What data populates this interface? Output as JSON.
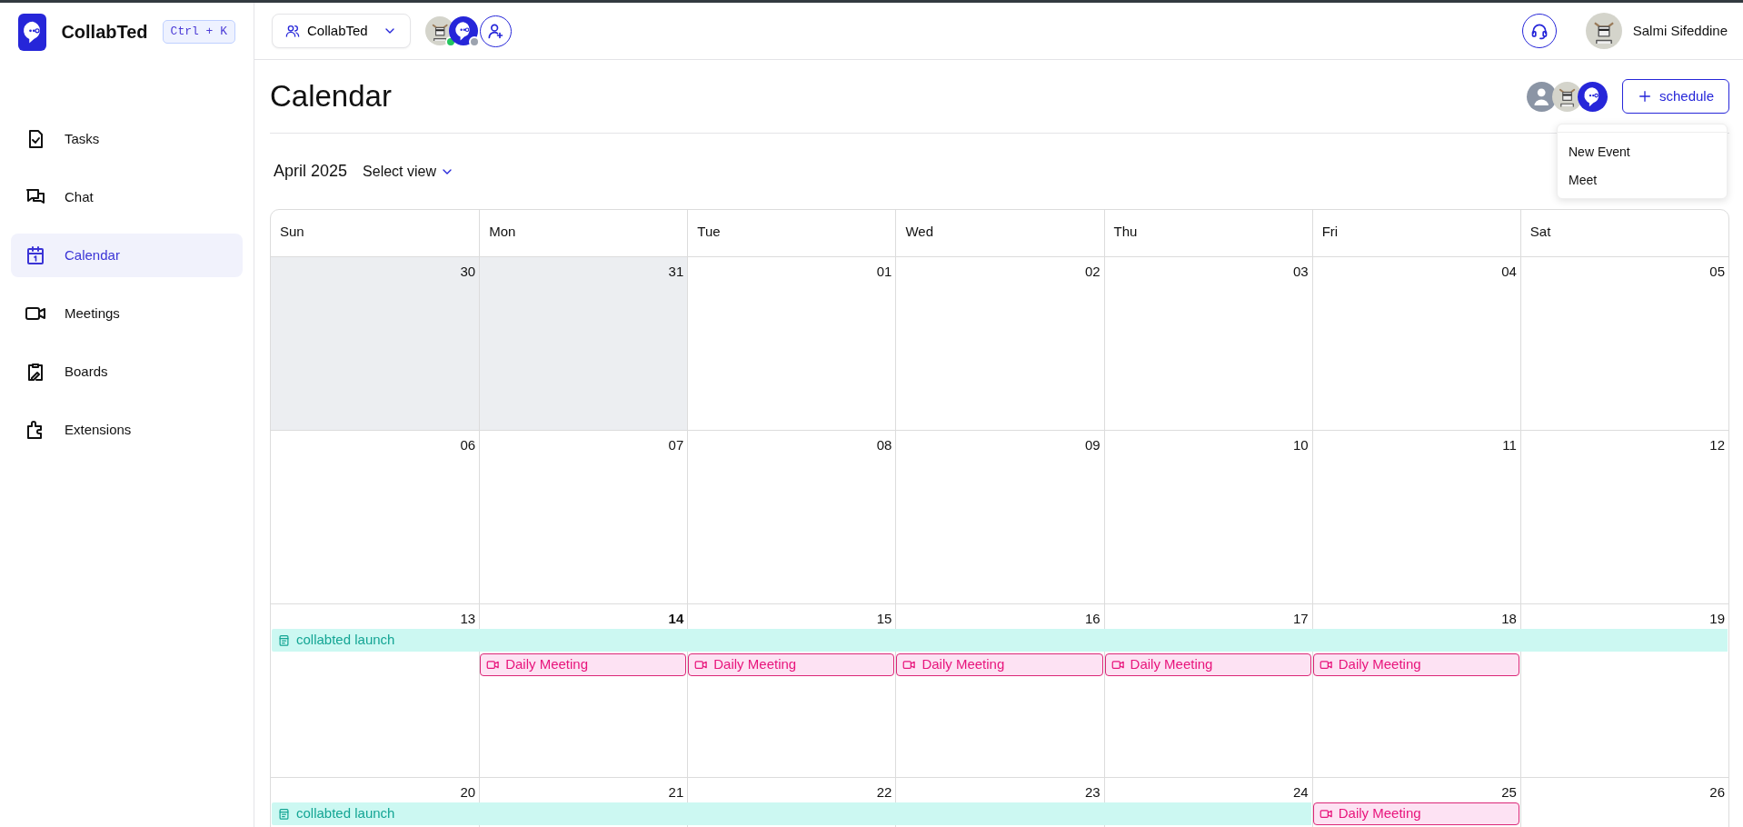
{
  "sidebar": {
    "brand": "CollabTed",
    "shortcut": "Ctrl + K",
    "items": [
      {
        "label": "Tasks",
        "kind": "tasks",
        "selected": false
      },
      {
        "label": "Chat",
        "kind": "chat",
        "selected": false
      },
      {
        "label": "Calendar",
        "kind": "calendar",
        "selected": true
      },
      {
        "label": "Meetings",
        "kind": "meetings",
        "selected": false
      },
      {
        "label": "Boards",
        "kind": "boards",
        "selected": false
      },
      {
        "label": "Extensions",
        "kind": "extensions",
        "selected": false
      }
    ]
  },
  "topbar": {
    "workspace": "CollabTed",
    "members": [
      {
        "kind": "avatar",
        "color": "#22c55e"
      },
      {
        "kind": "logo",
        "color": "#9ca3af"
      },
      {
        "kind": "invite"
      }
    ],
    "user": "Salmi Sifeddine"
  },
  "header": {
    "title": "Calendar",
    "participants": [
      {
        "kind": "user"
      },
      {
        "kind": "avatar"
      },
      {
        "kind": "logo"
      }
    ],
    "schedule_button": "schedule",
    "menu": {
      "open": true,
      "items": [
        "New Event",
        "Meet"
      ]
    }
  },
  "toolbar": {
    "month": "April 2025",
    "view_select": "Select view"
  },
  "calendar": {
    "weekdays": [
      "Sun",
      "Mon",
      "Tue",
      "Wed",
      "Thu",
      "Fri",
      "Sat"
    ],
    "weeks": [
      {
        "days": [
          {
            "date": "30",
            "outside": true,
            "today": false
          },
          {
            "date": "31",
            "outside": true,
            "today": false
          },
          {
            "date": "01",
            "outside": false,
            "today": false
          },
          {
            "date": "02",
            "outside": false,
            "today": false
          },
          {
            "date": "03",
            "outside": false,
            "today": false
          },
          {
            "date": "04",
            "outside": false,
            "today": false
          },
          {
            "date": "05",
            "outside": false,
            "today": false
          }
        ]
      },
      {
        "days": [
          {
            "date": "06",
            "outside": false,
            "today": false
          },
          {
            "date": "07",
            "outside": false,
            "today": false
          },
          {
            "date": "08",
            "outside": false,
            "today": false
          },
          {
            "date": "09",
            "outside": false,
            "today": false
          },
          {
            "date": "10",
            "outside": false,
            "today": false
          },
          {
            "date": "11",
            "outside": false,
            "today": false
          },
          {
            "date": "12",
            "outside": false,
            "today": false
          }
        ]
      },
      {
        "days": [
          {
            "date": "13",
            "outside": false,
            "today": false,
            "events": [
              {
                "kind": "task",
                "title": "collabted launch",
                "continued": false
              }
            ]
          },
          {
            "date": "14",
            "outside": false,
            "today": true,
            "events": [
              {
                "kind": "task",
                "continued": true
              },
              {
                "kind": "meeting",
                "title": "Daily Meeting",
                "continued": false
              }
            ]
          },
          {
            "date": "15",
            "outside": false,
            "today": false,
            "events": [
              {
                "kind": "task",
                "continued": true
              },
              {
                "kind": "meeting",
                "title": "Daily Meeting",
                "continued": false
              }
            ]
          },
          {
            "date": "16",
            "outside": false,
            "today": false,
            "events": [
              {
                "kind": "task",
                "continued": true
              },
              {
                "kind": "meeting",
                "title": "Daily Meeting",
                "continued": false
              }
            ]
          },
          {
            "date": "17",
            "outside": false,
            "today": false,
            "events": [
              {
                "kind": "task",
                "continued": true
              },
              {
                "kind": "meeting",
                "title": "Daily Meeting",
                "continued": false
              }
            ]
          },
          {
            "date": "18",
            "outside": false,
            "today": false,
            "events": [
              {
                "kind": "task",
                "continued": true
              },
              {
                "kind": "meeting",
                "title": "Daily Meeting",
                "continued": false
              }
            ]
          },
          {
            "date": "19",
            "outside": false,
            "today": false,
            "events": [
              {
                "kind": "task",
                "continued": true
              }
            ]
          }
        ]
      },
      {
        "days": [
          {
            "date": "20",
            "outside": false,
            "today": false,
            "events": [
              {
                "kind": "task",
                "title": "collabted launch",
                "continued": false
              }
            ]
          },
          {
            "date": "21",
            "outside": false,
            "today": false,
            "events": [
              {
                "kind": "task",
                "continued": true
              }
            ]
          },
          {
            "date": "22",
            "outside": false,
            "today": false,
            "events": [
              {
                "kind": "task",
                "continued": true
              }
            ]
          },
          {
            "date": "23",
            "outside": false,
            "today": false,
            "events": [
              {
                "kind": "task",
                "continued": true
              }
            ]
          },
          {
            "date": "24",
            "outside": false,
            "today": false,
            "events": [
              {
                "kind": "task",
                "continued": true
              }
            ]
          },
          {
            "date": "25",
            "outside": false,
            "today": false,
            "events": [
              {
                "kind": "meeting",
                "title": "Daily Meeting",
                "continued": false
              }
            ]
          },
          {
            "date": "26",
            "outside": false,
            "today": false
          }
        ]
      }
    ]
  }
}
